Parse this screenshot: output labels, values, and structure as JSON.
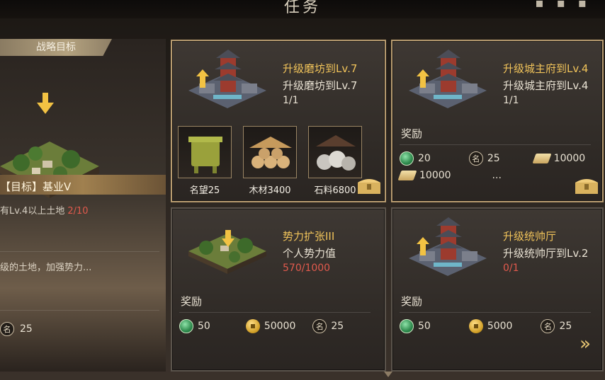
{
  "header": {
    "title": "任务"
  },
  "strategy": {
    "ribbon": "战略目标",
    "goal_title": "【目标】基业V",
    "requirement": "有Lv.4以上土地",
    "requirement_progress": "2/10",
    "description": "级的土地，加强势力...",
    "reward_fame": "25"
  },
  "tasks": [
    {
      "name": "升级磨坊到Lv.7",
      "desc": "升级磨坊到Lv.7",
      "progress": "1/1",
      "popup_items": [
        {
          "icon": "bronze-cauldron-icon",
          "label": "名望25"
        },
        {
          "icon": "wood-logs-icon",
          "label": "木材3400"
        },
        {
          "icon": "stone-pile-icon",
          "label": "石料6800"
        }
      ]
    },
    {
      "name": "升级城主府到Lv.4",
      "desc": "升级城主府到Lv.4",
      "progress": "1/1",
      "reward_label": "奖励",
      "rewards": {
        "jade": "20",
        "fame": "25",
        "wood": "10000",
        "stone": "10000",
        "more": "..."
      }
    },
    {
      "name": "势力扩张III",
      "desc": "个人势力值",
      "progress": "570/1000",
      "reward_label": "奖励",
      "rewards": {
        "jade": "50",
        "gold": "50000",
        "fame": "25"
      }
    },
    {
      "name": "升级统帅厅",
      "desc": "升级统帅厅到Lv.2",
      "progress": "0/1",
      "reward_label": "奖励",
      "rewards": {
        "jade": "50",
        "gold": "5000",
        "fame": "25"
      }
    }
  ],
  "icons": {
    "jade_char": "",
    "fame_char": "名",
    "next": "»"
  },
  "colors": {
    "accent_gold": "#f0c35a",
    "progress_red": "#e25a4d",
    "border_gold": "#b79b6f"
  }
}
